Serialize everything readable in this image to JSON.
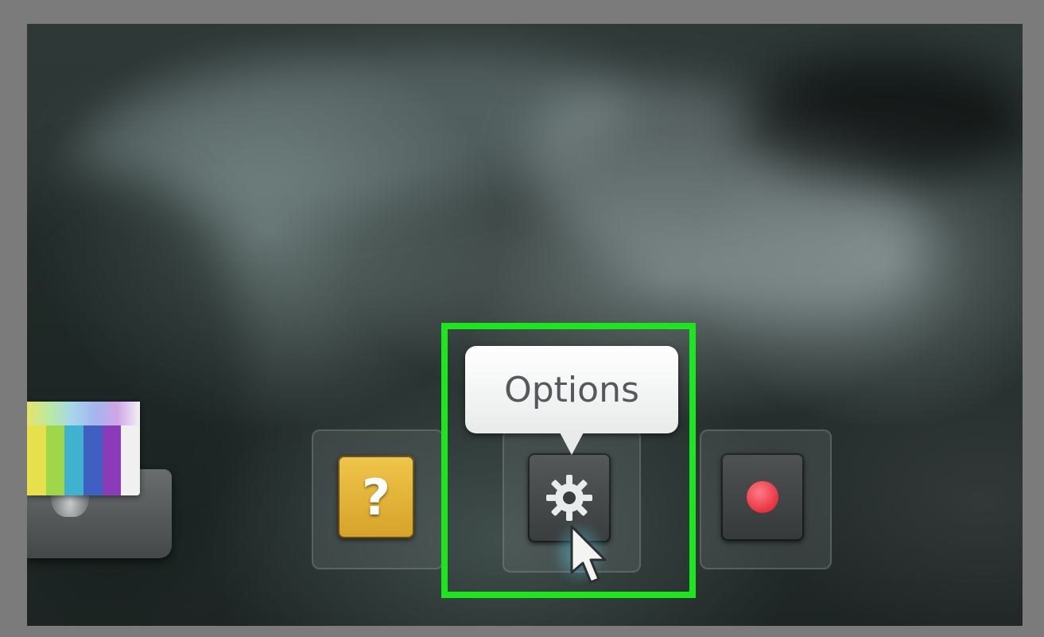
{
  "toolbar": {
    "help": {
      "label": "?",
      "icon": "question-mark-icon",
      "color": "#e0ad33"
    },
    "options": {
      "icon": "gear-icon",
      "tooltip": "Options"
    },
    "record": {
      "icon": "record-dot-icon",
      "color": "#e8323f"
    }
  },
  "highlight": {
    "color": "#1ee61e"
  },
  "device": {
    "icon": "tv-color-bars-icon",
    "color_bars": [
      "#e6e04c",
      "#9fd64a",
      "#3fb2cf",
      "#3f5fc2",
      "#8a3bb8",
      "#f0f0f0"
    ]
  }
}
